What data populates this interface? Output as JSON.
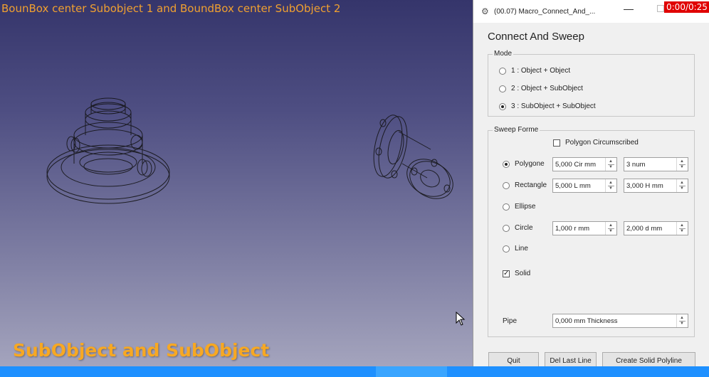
{
  "viewport": {
    "caption": "BounBox center Subobject 1 and BoundBox center SubObject 2",
    "overlay_title": "SubObject and SubObject"
  },
  "dialog": {
    "title": "(00.07) Macro_Connect_And_...",
    "timer": "0:00/0:25",
    "heading": "Connect And Sweep",
    "mode": {
      "title": "Mode",
      "options": [
        {
          "label": "1 : Object + Object",
          "checked": false
        },
        {
          "label": "2 : Object + SubObject",
          "checked": false
        },
        {
          "label": "3 : SubObject + SubObject",
          "checked": true
        }
      ]
    },
    "sweep": {
      "title": "Sweep Forme",
      "polygon_circumscribed": {
        "label": "Polygon Circumscribed",
        "checked": false
      },
      "polygone": {
        "label": "Polygone",
        "checked": true,
        "value1": "5,000 Cir mm",
        "value2": "3 num"
      },
      "rectangle": {
        "label": "Rectangle",
        "checked": false,
        "value1": "5,000 L mm",
        "value2": "3,000 H mm"
      },
      "ellipse": {
        "label": "Ellipse",
        "checked": false
      },
      "circle": {
        "label": "Circle",
        "checked": false,
        "value1": "1,000 r mm",
        "value2": "2,000 d mm"
      },
      "line": {
        "label": "Line",
        "checked": false
      },
      "solid": {
        "label": "Solid",
        "checked": true
      },
      "pipe": {
        "label": "Pipe",
        "value": "0,000 mm Thickness"
      }
    },
    "buttons": {
      "quit": "Quit",
      "del_last_line": "Del Last Line",
      "create_solid_polyline": "Create Solid Polyline"
    }
  },
  "colors": {
    "caption": "#f0a030",
    "overlay": "#f7a823",
    "timer_bg": "#e00000",
    "taskbar": "#1e90ff"
  }
}
